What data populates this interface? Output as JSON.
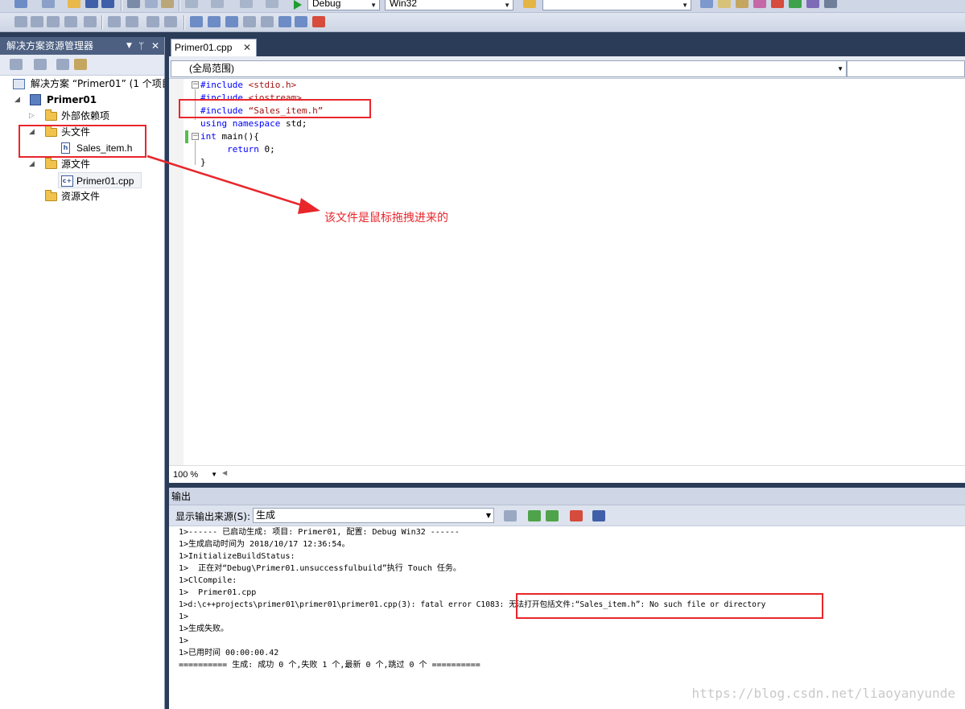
{
  "toolbar": {
    "config": "Debug",
    "platform": "Win32",
    "find_value": ""
  },
  "solution_explorer": {
    "title": "解决方案资源管理器",
    "pin": "ᛘ",
    "close": "✕",
    "items": [
      {
        "label": "解决方案 “Primer01” (1 个项目)"
      },
      {
        "label": "Primer01"
      },
      {
        "label": "外部依赖项"
      },
      {
        "label": "头文件"
      },
      {
        "label": "Sales_item.h"
      },
      {
        "label": "源文件"
      },
      {
        "label": "Primer01.cpp"
      },
      {
        "label": "资源文件"
      }
    ]
  },
  "editor": {
    "tab_label": "Primer01.cpp",
    "tab_close": "✕",
    "scope": "(全局范围)",
    "zoom": "100 %",
    "code": [
      "#include <stdio.h>",
      "#include <iostream>",
      "#include “Sales_item.h”",
      "using namespace std;",
      "int main(){",
      "     return 0;",
      "}"
    ]
  },
  "output": {
    "title": "输出",
    "source_label": "显示输出来源(S):",
    "source_value": "生成",
    "lines": [
      "1>------ 已启动生成: 项目: Primer01, 配置: Debug Win32 ------",
      "1>生成启动时间为 2018/10/17 12:36:54。",
      "1>InitializeBuildStatus:",
      "1>  正在对“Debug\\Primer01.unsuccessfulbuild”执行 Touch 任务。",
      "1>ClCompile:",
      "1>  Primer01.cpp",
      "1>d:\\c++projects\\primer01\\primer01\\primer01.cpp(3): fatal error C1083: 无法打开包括文件:“Sales_item.h”: No such file or directory",
      "1>",
      "1>生成失败。",
      "1>",
      "1>已用时间 00:00:00.42",
      "========== 生成: 成功 0 个,失败 1 个,最新 0 个,跳过 0 个 =========="
    ]
  },
  "annotation": {
    "note": "该文件是鼠标拖拽进来的",
    "color": "#e8262b"
  },
  "watermark": "https://blog.csdn.net/liaoyanyunde"
}
